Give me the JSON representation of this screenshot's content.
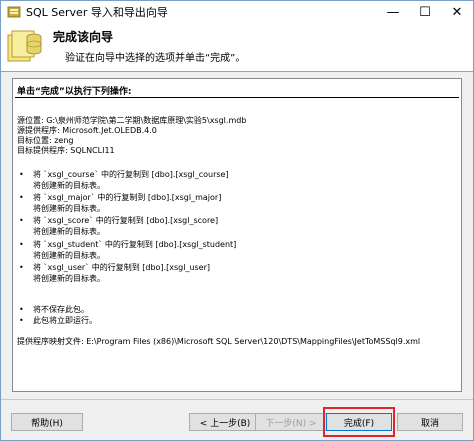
{
  "window": {
    "title": "SQL Server 导入和导出向导",
    "minimize_glyph": "—",
    "maximize_glyph": "☐",
    "close_glyph": "✕"
  },
  "header": {
    "title": "完成该向导",
    "subtitle": "验证在向导中选择的选项并单击“完成”。"
  },
  "summary": {
    "heading": "单击“完成”以执行下列操作:",
    "source_location": "源位置: G:\\泉州师范学院\\第二学期\\数据库原理\\实验5\\xsgl.mdb",
    "source_provider": "源提供程序: Microsoft.Jet.OLEDB.4.0",
    "target_location": "目标位置: zeng",
    "target_provider": "目标提供程序: SQLNCLI11",
    "copy_ops": [
      {
        "line1": "将 `xsgl_course` 中的行复制到 [dbo].[xsgl_course]",
        "line2": "将创建新的目标表。"
      },
      {
        "line1": "将 `xsgl_major` 中的行复制到 [dbo].[xsgl_major]",
        "line2": "将创建新的目标表。"
      },
      {
        "line1": "将 `xsgl_score` 中的行复制到 [dbo].[xsgl_score]",
        "line2": "将创建新的目标表。"
      },
      {
        "line1": "将 `xsgl_student` 中的行复制到 [dbo].[xsgl_student]",
        "line2": "将创建新的目标表。"
      },
      {
        "line1": "将 `xsgl_user` 中的行复制到 [dbo].[xsgl_user]",
        "line2": "将创建新的目标表。"
      }
    ],
    "bullet_glyph": "•",
    "final_ops": [
      "将不保存此包。",
      "此包将立即运行。"
    ],
    "mapping_file": "提供程序映射文件: E:\\Program Files (x86)\\Microsoft SQL Server\\120\\DTS\\MappingFiles\\JetToMSSql9.xml"
  },
  "buttons": {
    "help": "帮助(H)",
    "back": "< 上一步(B)",
    "next": "下一步(N) >",
    "finish": "完成(F)",
    "cancel": "取消"
  },
  "colors": {
    "highlight": "#e0262a",
    "accent": "#0078d7"
  }
}
